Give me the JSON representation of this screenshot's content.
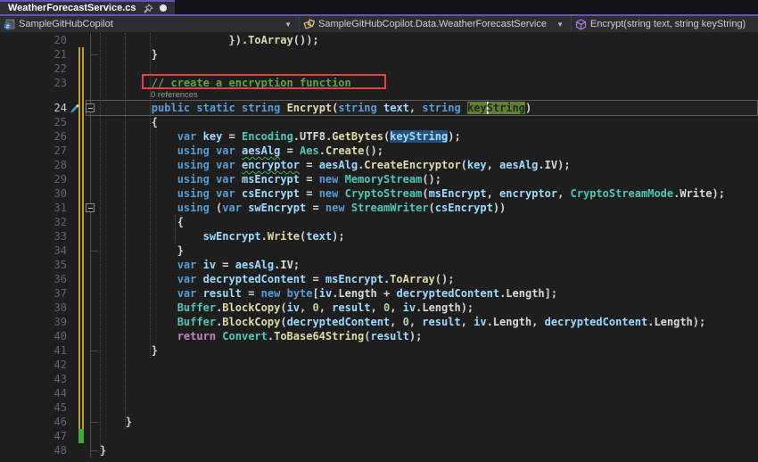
{
  "tab": {
    "title": "WeatherForecastService.cs"
  },
  "navbar": {
    "project": "SampleGitHubCopilot",
    "class_path": "SampleGitHubCopilot.Data.WeatherForecastService",
    "member": "Encrypt(string text, string keyString)"
  },
  "icons": {
    "pin-icon": "document pin",
    "modified-dot-icon": "unsaved changes dot",
    "csproj-icon": "c# project",
    "class-icon": "class",
    "method-icon": "method cube",
    "dropdown-caret-icon": "▾",
    "edit-pen-icon": "edit pen marker",
    "fold-collapse-icon": "−"
  },
  "colors": {
    "accent_purple": "#6157b8",
    "comment_green": "#57a64a",
    "annotation_red": "#e5413d",
    "change_bar_unsaved": "#bfa22e",
    "change_bar_saved": "#45a83e",
    "selection_blue": "#264f78",
    "rename_highlight_green": "#5f7e33"
  },
  "editor": {
    "lines": [
      {
        "n": 20,
        "segs": [
          [
            "                    }).",
            "p"
          ],
          [
            "ToArray",
            "m"
          ],
          [
            "());",
            "p"
          ]
        ]
      },
      {
        "n": 21,
        "segs": [
          [
            "        }",
            "p"
          ]
        ]
      },
      {
        "n": 22,
        "segs": []
      },
      {
        "n": 23,
        "segs": [
          [
            "        ",
            "p"
          ],
          [
            "// create a encryption function",
            "cm"
          ]
        ]
      },
      {
        "n": 24,
        "active": true,
        "lens": "0 references",
        "segs": [
          [
            "        ",
            "p"
          ],
          [
            "public",
            "k"
          ],
          [
            " ",
            "p"
          ],
          [
            "static",
            "k"
          ],
          [
            " ",
            "p"
          ],
          [
            "string",
            "k"
          ],
          [
            " ",
            "p"
          ],
          [
            "Encrypt",
            "m"
          ],
          [
            "(",
            "p"
          ],
          [
            "string",
            "k"
          ],
          [
            " ",
            "p"
          ],
          [
            "text",
            "v"
          ],
          [
            ", ",
            "p"
          ],
          [
            "string",
            "k"
          ],
          [
            " ",
            "p"
          ],
          [
            "key",
            "hg"
          ],
          [
            "String",
            "hg caret-l"
          ],
          [
            ")",
            "p"
          ]
        ]
      },
      {
        "n": 25,
        "segs": [
          [
            "        {",
            "p"
          ]
        ]
      },
      {
        "n": 26,
        "segs": [
          [
            "            ",
            "p"
          ],
          [
            "var",
            "k"
          ],
          [
            " ",
            "p"
          ],
          [
            "key",
            "v"
          ],
          [
            " = ",
            "p"
          ],
          [
            "Encoding",
            "t"
          ],
          [
            ".",
            "p"
          ],
          [
            "UTF8",
            "w"
          ],
          [
            ".",
            "p"
          ],
          [
            "GetBytes",
            "m"
          ],
          [
            "(",
            "p"
          ],
          [
            "keyString",
            "v hb"
          ],
          [
            ");",
            "p"
          ]
        ]
      },
      {
        "n": 27,
        "segs": [
          [
            "            ",
            "p"
          ],
          [
            "using",
            "k"
          ],
          [
            " ",
            "p"
          ],
          [
            "var",
            "k"
          ],
          [
            " ",
            "p"
          ],
          [
            "aesAlg",
            "v wavy"
          ],
          [
            " = ",
            "p"
          ],
          [
            "Aes",
            "t"
          ],
          [
            ".",
            "p"
          ],
          [
            "Create",
            "m"
          ],
          [
            "();",
            "p"
          ]
        ]
      },
      {
        "n": 28,
        "segs": [
          [
            "            ",
            "p"
          ],
          [
            "using",
            "k"
          ],
          [
            " ",
            "p"
          ],
          [
            "var",
            "k"
          ],
          [
            " ",
            "p"
          ],
          [
            "encryptor",
            "v wavy"
          ],
          [
            " = ",
            "p"
          ],
          [
            "aesAlg",
            "v"
          ],
          [
            ".",
            "p"
          ],
          [
            "CreateEncryptor",
            "m"
          ],
          [
            "(",
            "p"
          ],
          [
            "key",
            "v"
          ],
          [
            ", ",
            "p"
          ],
          [
            "aesAlg",
            "v"
          ],
          [
            ".",
            "p"
          ],
          [
            "IV",
            "w"
          ],
          [
            ");",
            "p"
          ]
        ]
      },
      {
        "n": 29,
        "segs": [
          [
            "            ",
            "p"
          ],
          [
            "using",
            "k"
          ],
          [
            " ",
            "p"
          ],
          [
            "var",
            "k"
          ],
          [
            " ",
            "p"
          ],
          [
            "msEncrypt",
            "v"
          ],
          [
            " = ",
            "p"
          ],
          [
            "new",
            "k"
          ],
          [
            " ",
            "p"
          ],
          [
            "MemoryStream",
            "t"
          ],
          [
            "();",
            "p"
          ]
        ]
      },
      {
        "n": 30,
        "segs": [
          [
            "            ",
            "p"
          ],
          [
            "using",
            "k"
          ],
          [
            " ",
            "p"
          ],
          [
            "var",
            "k"
          ],
          [
            " ",
            "p"
          ],
          [
            "csEncrypt",
            "v"
          ],
          [
            " = ",
            "p"
          ],
          [
            "new",
            "k"
          ],
          [
            " ",
            "p"
          ],
          [
            "CryptoStream",
            "t"
          ],
          [
            "(",
            "p"
          ],
          [
            "msEncrypt",
            "v"
          ],
          [
            ", ",
            "p"
          ],
          [
            "encryptor",
            "v"
          ],
          [
            ", ",
            "p"
          ],
          [
            "CryptoStreamMode",
            "t"
          ],
          [
            ".",
            "p"
          ],
          [
            "Write",
            "w"
          ],
          [
            ");",
            "p"
          ]
        ]
      },
      {
        "n": 31,
        "fold": true,
        "segs": [
          [
            "            ",
            "p"
          ],
          [
            "using",
            "k"
          ],
          [
            " (",
            "p"
          ],
          [
            "var",
            "k"
          ],
          [
            " ",
            "p"
          ],
          [
            "swEncrypt",
            "v"
          ],
          [
            " = ",
            "p"
          ],
          [
            "new",
            "k"
          ],
          [
            " ",
            "p"
          ],
          [
            "StreamWriter",
            "t"
          ],
          [
            "(",
            "p"
          ],
          [
            "csEncrypt",
            "v"
          ],
          [
            "))",
            "p"
          ]
        ]
      },
      {
        "n": 32,
        "segs": [
          [
            "            {",
            "p"
          ]
        ]
      },
      {
        "n": 33,
        "segs": [
          [
            "                ",
            "p"
          ],
          [
            "swEncrypt",
            "v"
          ],
          [
            ".",
            "p"
          ],
          [
            "Write",
            "m"
          ],
          [
            "(",
            "p"
          ],
          [
            "text",
            "v"
          ],
          [
            ");",
            "p"
          ]
        ]
      },
      {
        "n": 34,
        "segs": [
          [
            "            }",
            "p"
          ]
        ]
      },
      {
        "n": 35,
        "segs": [
          [
            "            ",
            "p"
          ],
          [
            "var",
            "k"
          ],
          [
            " ",
            "p"
          ],
          [
            "iv",
            "v"
          ],
          [
            " = ",
            "p"
          ],
          [
            "aesAlg",
            "v"
          ],
          [
            ".",
            "p"
          ],
          [
            "IV",
            "w"
          ],
          [
            ";",
            "p"
          ]
        ]
      },
      {
        "n": 36,
        "segs": [
          [
            "            ",
            "p"
          ],
          [
            "var",
            "k"
          ],
          [
            " ",
            "p"
          ],
          [
            "decryptedContent",
            "v"
          ],
          [
            " = ",
            "p"
          ],
          [
            "msEncrypt",
            "v"
          ],
          [
            ".",
            "p"
          ],
          [
            "ToArray",
            "m"
          ],
          [
            "();",
            "p"
          ]
        ]
      },
      {
        "n": 37,
        "segs": [
          [
            "            ",
            "p"
          ],
          [
            "var",
            "k"
          ],
          [
            " ",
            "p"
          ],
          [
            "result",
            "v"
          ],
          [
            " = ",
            "p"
          ],
          [
            "new",
            "k"
          ],
          [
            " ",
            "p"
          ],
          [
            "byte",
            "k"
          ],
          [
            "[",
            "p"
          ],
          [
            "iv",
            "v"
          ],
          [
            ".",
            "p"
          ],
          [
            "Length",
            "w"
          ],
          [
            " + ",
            "p"
          ],
          [
            "decryptedContent",
            "v"
          ],
          [
            ".",
            "p"
          ],
          [
            "Length",
            "w"
          ],
          [
            "];",
            "p"
          ]
        ]
      },
      {
        "n": 38,
        "segs": [
          [
            "            ",
            "p"
          ],
          [
            "Buffer",
            "t"
          ],
          [
            ".",
            "p"
          ],
          [
            "BlockCopy",
            "m"
          ],
          [
            "(",
            "p"
          ],
          [
            "iv",
            "v"
          ],
          [
            ", ",
            "p"
          ],
          [
            "0",
            "n"
          ],
          [
            ", ",
            "p"
          ],
          [
            "result",
            "v"
          ],
          [
            ", ",
            "p"
          ],
          [
            "0",
            "n"
          ],
          [
            ", ",
            "p"
          ],
          [
            "iv",
            "v"
          ],
          [
            ".",
            "p"
          ],
          [
            "Length",
            "w"
          ],
          [
            ");",
            "p"
          ]
        ]
      },
      {
        "n": 39,
        "segs": [
          [
            "            ",
            "p"
          ],
          [
            "Buffer",
            "t"
          ],
          [
            ".",
            "p"
          ],
          [
            "BlockCopy",
            "m"
          ],
          [
            "(",
            "p"
          ],
          [
            "decryptedContent",
            "v"
          ],
          [
            ", ",
            "p"
          ],
          [
            "0",
            "n"
          ],
          [
            ", ",
            "p"
          ],
          [
            "result",
            "v"
          ],
          [
            ", ",
            "p"
          ],
          [
            "iv",
            "v"
          ],
          [
            ".",
            "p"
          ],
          [
            "Length",
            "w"
          ],
          [
            ", ",
            "p"
          ],
          [
            "decryptedContent",
            "v"
          ],
          [
            ".",
            "p"
          ],
          [
            "Length",
            "w"
          ],
          [
            ");",
            "p"
          ]
        ]
      },
      {
        "n": 40,
        "segs": [
          [
            "            ",
            "p"
          ],
          [
            "return",
            "c"
          ],
          [
            " ",
            "p"
          ],
          [
            "Convert",
            "t"
          ],
          [
            ".",
            "p"
          ],
          [
            "ToBase64String",
            "m"
          ],
          [
            "(",
            "p"
          ],
          [
            "result",
            "v"
          ],
          [
            ");",
            "p"
          ]
        ]
      },
      {
        "n": 41,
        "segs": [
          [
            "        }",
            "p"
          ]
        ]
      },
      {
        "n": 42,
        "segs": []
      },
      {
        "n": 43,
        "segs": []
      },
      {
        "n": 44,
        "segs": []
      },
      {
        "n": 45,
        "segs": []
      },
      {
        "n": 46,
        "segs": [
          [
            "    }",
            "p"
          ]
        ]
      },
      {
        "n": 47,
        "segs": []
      },
      {
        "n": 48,
        "segs": [
          [
            "}",
            "p"
          ]
        ]
      }
    ]
  }
}
